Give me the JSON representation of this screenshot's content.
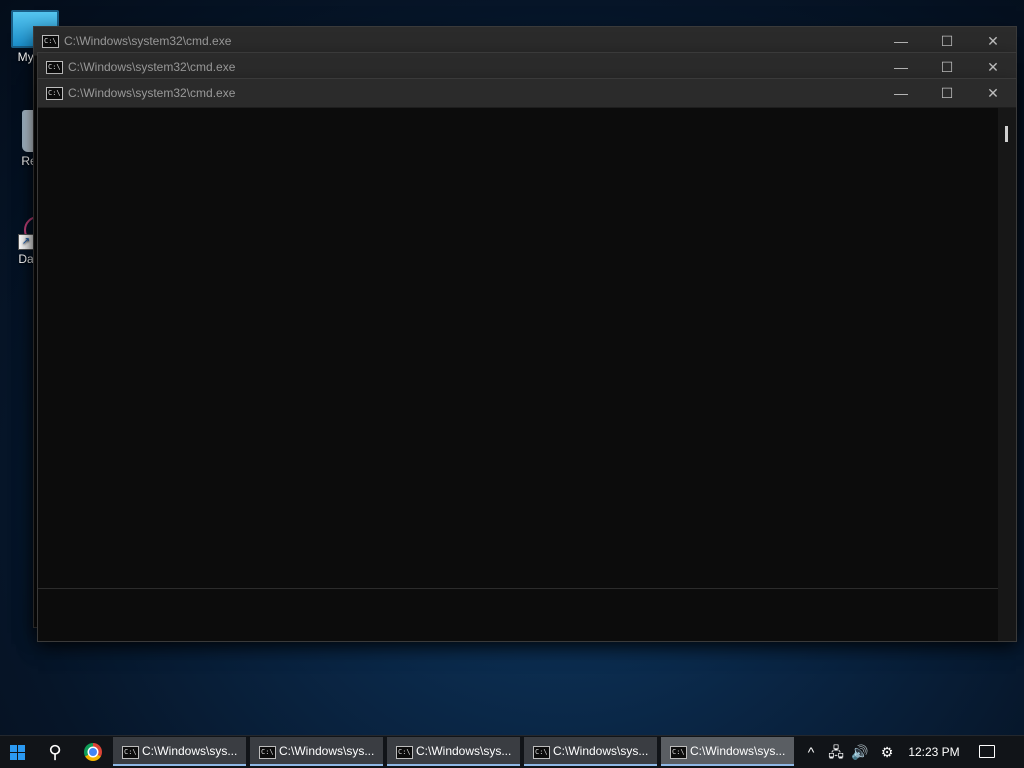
{
  "desktop": {
    "icons": [
      {
        "label": "My Co",
        "icon": "monitor-icon"
      },
      {
        "label": "Recy",
        "icon": "recycle-bin-icon"
      },
      {
        "label": "DataV",
        "icon": "dataviz-shortcut-icon"
      }
    ]
  },
  "windows": [
    {
      "title": "C:\\Windows\\system32\\cmd.exe",
      "icon": "cmd-icon"
    },
    {
      "title": "C:\\Windows\\system32\\cmd.exe",
      "icon": "cmd-icon"
    },
    {
      "title": "C:\\Windows\\system32\\cmd.exe",
      "icon": "cmd-icon"
    }
  ],
  "window_controls": {
    "minimize": "—",
    "maximize": "☐",
    "close": "✕"
  },
  "cmd_glyph": "C:\\",
  "taskbar": {
    "search_glyph": "⚲",
    "items": [
      {
        "label": "C:\\Windows\\sys..."
      },
      {
        "label": "C:\\Windows\\sys..."
      },
      {
        "label": "C:\\Windows\\sys..."
      },
      {
        "label": "C:\\Windows\\sys..."
      },
      {
        "label": "C:\\Windows\\sys..."
      }
    ],
    "tray": {
      "chevron": "^",
      "network": "🖧",
      "volume": "🔊",
      "settings": "⚙"
    },
    "clock": "12:23 PM"
  },
  "colors": {
    "accent": "#2b9af3",
    "console_bg": "#0c0c0c",
    "titlebar_bg": "#2b2b2b"
  }
}
